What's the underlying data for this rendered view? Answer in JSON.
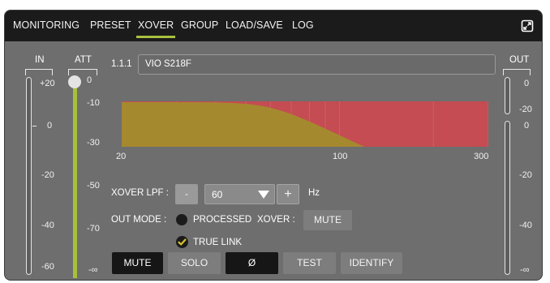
{
  "tabs": [
    {
      "label": "MONITORING"
    },
    {
      "label": "PRESET"
    },
    {
      "label": "XOVER",
      "active": true
    },
    {
      "label": "GROUP"
    },
    {
      "label": "LOAD/SAVE"
    },
    {
      "label": "LOG"
    }
  ],
  "icons": {
    "expand": "expand-icon",
    "check": "checkmark-icon"
  },
  "colors": {
    "accent": "#a9c23f",
    "panel": "#6e6e6e",
    "topbar": "#1b1b1b",
    "curve_fill": "#c44c52",
    "pass_fill": "#a5892f"
  },
  "meters": {
    "in_label": "IN",
    "att_label": "ATT",
    "out_label": "OUT",
    "in_scale": [
      "+20",
      "0",
      "-20",
      "-40",
      "-60"
    ],
    "att_scale": [
      "0",
      "-10",
      "-30",
      "-50",
      "-70",
      "-∞"
    ],
    "out_scale": [
      "0",
      "-20",
      "0",
      "-20",
      "-40",
      "-∞"
    ],
    "att_level": 1.0
  },
  "channel": {
    "id": "1.1.1",
    "name": "VIO S218F"
  },
  "chart_data": {
    "type": "area",
    "x_ticks": [
      "20",
      "100",
      "300"
    ],
    "xlim": [
      20,
      300
    ],
    "x_scale": "log",
    "filter": {
      "type": "lowpass",
      "cutoff_hz": 60
    },
    "colors": {
      "response": "#a5892f",
      "background": "#c44c52"
    }
  },
  "xover": {
    "lpf_label": "XOVER LPF :",
    "minus": "-",
    "value": "60",
    "plus": "+",
    "unit": "Hz",
    "out_mode_label": "OUT MODE :",
    "processed_label": "PROCESSED",
    "xover_label": "XOVER :",
    "mute_label": "MUTE",
    "true_link_label": "TRUE LINK"
  },
  "bottom_buttons": {
    "mute": "MUTE",
    "solo": "SOLO",
    "phase": "Ø",
    "test": "TEST",
    "identify": "IDENTIFY"
  }
}
